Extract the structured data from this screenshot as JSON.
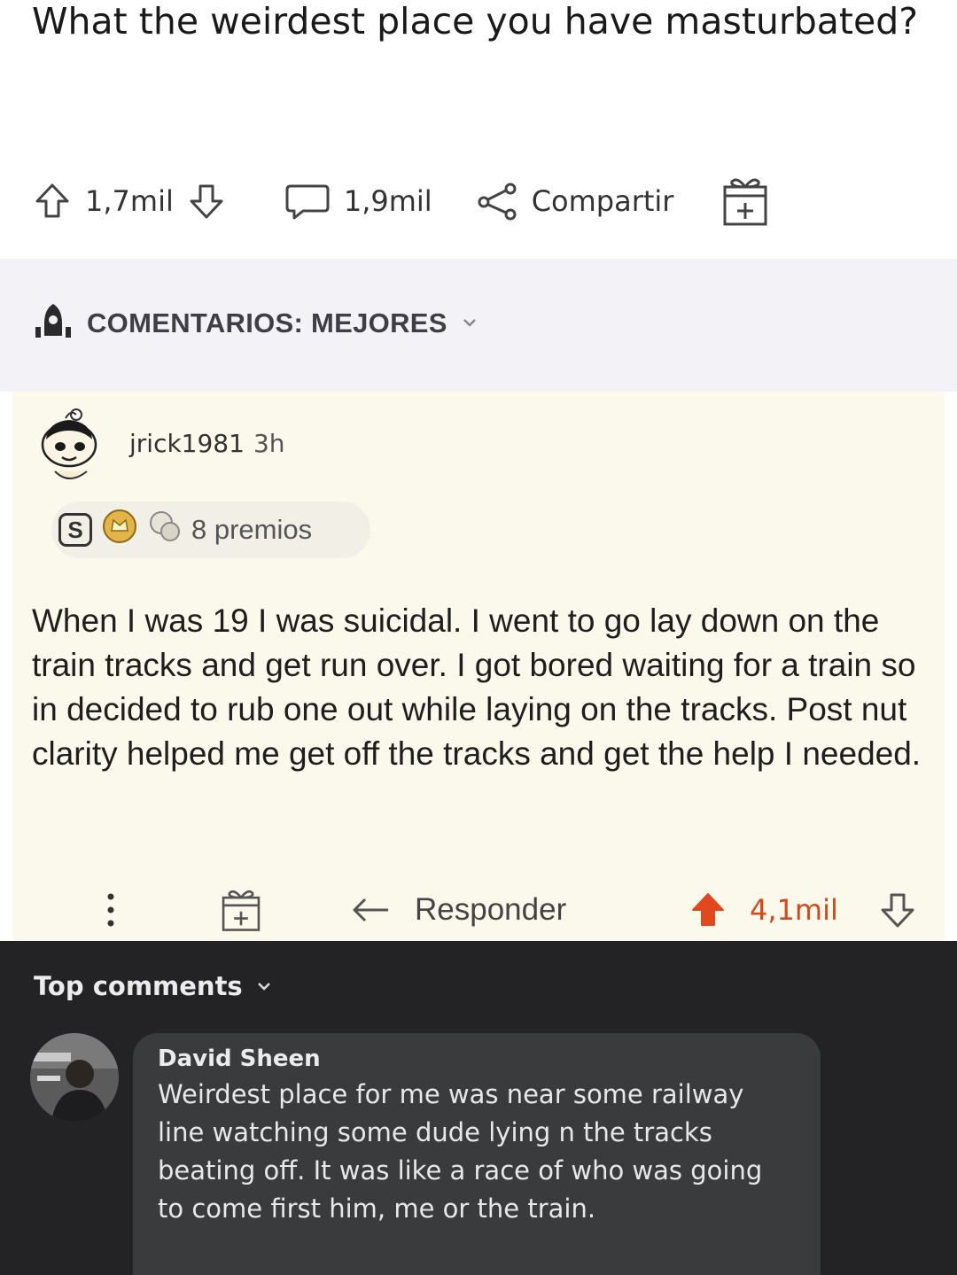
{
  "post": {
    "title": "What the weirdest place you have masturbated?",
    "upvotes": "1,7mil",
    "comments": "1,9mil",
    "share_label": "Compartir"
  },
  "sort": {
    "label": "COMENTARIOS: MEJORES"
  },
  "comment": {
    "username": "jrick1981",
    "time": "3h",
    "awards_label": "8 premios",
    "award_badge": "S",
    "body": "When I was 19 I was suicidal. I went to go lay down on the train tracks and get run over. I got bored waiting for a train so in decided to rub one out while laying on the tracks. Post nut clarity helped me get off the tracks and get the help I needed.",
    "reply_label": "Responder",
    "score": "4,1mil",
    "upvote_color": "#e0481e"
  },
  "facebook": {
    "section_label": "Top comments",
    "author": "David Sheen",
    "text": "Weirdest place for me was near some railway line watching some dude lying n the tracks beating off. It was like a race of who was going to come first him, me or the train."
  }
}
